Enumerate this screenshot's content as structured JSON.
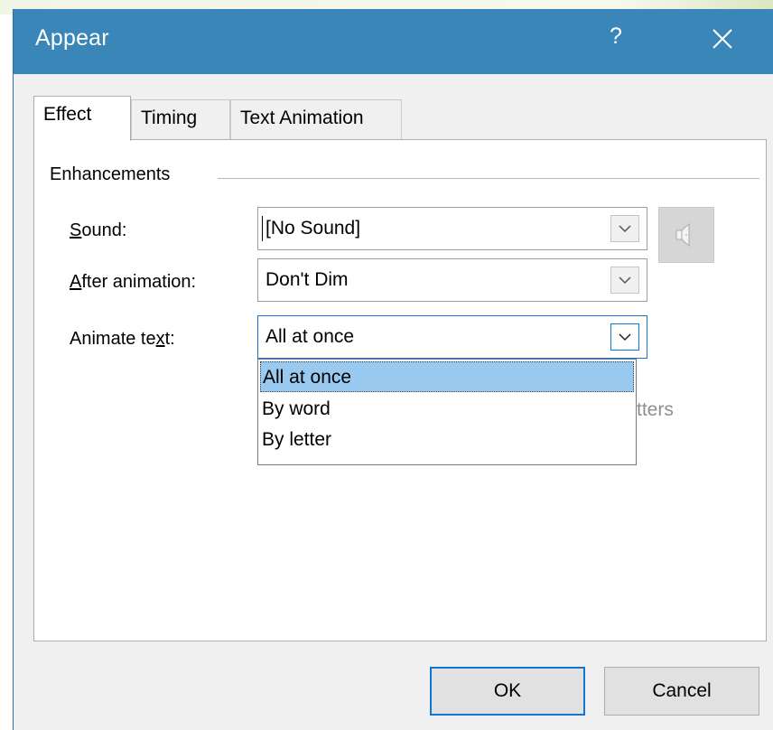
{
  "dialog": {
    "title": "Appear",
    "help": "?",
    "accent_color": "#3a86b8"
  },
  "tabs": [
    {
      "label": "Effect",
      "active": true
    },
    {
      "label": "Timing",
      "active": false
    },
    {
      "label": "Text Animation",
      "active": false
    }
  ],
  "enhancements": {
    "group_label": "Enhancements",
    "sound": {
      "label": "Sound:",
      "accel": "S",
      "value": "[No Sound]"
    },
    "after_animation": {
      "label": "After animation:",
      "accel": "A",
      "value": "Don't Dim"
    },
    "animate_text": {
      "label_prefix": "Animate te",
      "accel": "x",
      "label_suffix": "t:",
      "value": "All at once",
      "options": [
        "All at once",
        "By word",
        "By letter"
      ],
      "selected_index": 0
    },
    "partially_hidden_text": "tters"
  },
  "buttons": {
    "ok": "OK",
    "cancel": "Cancel"
  }
}
